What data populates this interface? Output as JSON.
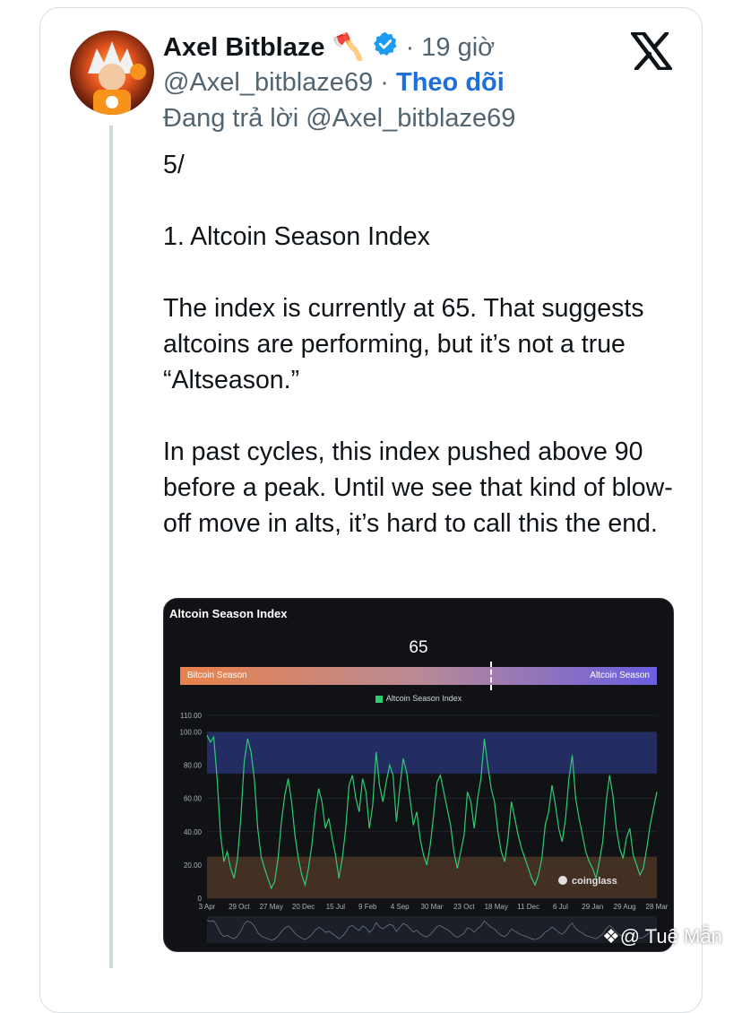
{
  "tweet": {
    "author_name": "Axel Bitblaze",
    "author_emoji": "🪓",
    "time_ago": "19 giờ",
    "handle": "@Axel_bitblaze69",
    "follow_label": "Theo dõi",
    "replying_to": "Đang trả lời @Axel_bitblaze69",
    "paragraphs": [
      "5/",
      "1. Altcoin Season Index",
      "The index is currently at 65. That suggests altcoins are performing, but it’s not a true “Altseason.”",
      "In past cycles, this index pushed above 90 before a peak. Until we see that kind of blow-off move in alts, it’s hard to call this the end."
    ]
  },
  "chart_image": {
    "title": "Altcoin Season Index",
    "current_value": "65",
    "gauge_left": "Bitcoin Season",
    "gauge_right": "Altcoin Season",
    "brand": "coinglass",
    "accent_line": "#2ecc71",
    "altcoin_zone": "#26306b",
    "bitcoin_zone": "#4a3325"
  },
  "chart_data": {
    "type": "line",
    "title": "Altcoin Season Index",
    "series": [
      {
        "name": "Altcoin Season Index",
        "values": [
          98,
          94,
          97,
          72,
          38,
          22,
          28,
          18,
          12,
          24,
          48,
          82,
          96,
          88,
          72,
          42,
          25,
          18,
          12,
          6,
          10,
          24,
          46,
          62,
          72,
          58,
          38,
          24,
          14,
          8,
          18,
          32,
          52,
          66,
          58,
          42,
          48,
          36,
          26,
          12,
          24,
          42,
          68,
          74,
          60,
          52,
          72,
          64,
          42,
          56,
          88,
          68,
          58,
          70,
          80,
          74,
          46,
          66,
          84,
          76,
          60,
          44,
          52,
          36,
          26,
          20,
          32,
          50,
          70,
          74,
          64,
          54,
          44,
          28,
          18,
          28,
          38,
          64,
          58,
          42,
          60,
          72,
          96,
          80,
          66,
          58,
          40,
          28,
          22,
          36,
          58,
          48,
          38,
          30,
          24,
          18,
          12,
          8,
          14,
          24,
          44,
          52,
          68,
          56,
          42,
          34,
          48,
          72,
          86,
          60,
          48,
          38,
          28,
          22,
          18,
          12,
          22,
          34,
          58,
          74,
          62,
          42,
          30,
          24,
          36,
          42,
          26,
          20,
          14,
          18,
          30,
          44,
          54,
          64
        ]
      }
    ],
    "x_ticks": [
      "3 Apr",
      "29 Oct",
      "27 May",
      "20 Dec",
      "15 Jul",
      "9 Feb",
      "4 Sep",
      "30 Mar",
      "23 Oct",
      "18 May",
      "11 Dec",
      "6 Jul",
      "29 Jan",
      "29 Aug",
      "28 Mar"
    ],
    "y_ticks": [
      "0",
      "20.00",
      "40.00",
      "60.00",
      "80.00",
      "100.00",
      "110.00"
    ],
    "ylim": [
      0,
      110
    ],
    "legend": "top-center",
    "current": 65
  },
  "watermark": "@ Tuệ Mẫn"
}
